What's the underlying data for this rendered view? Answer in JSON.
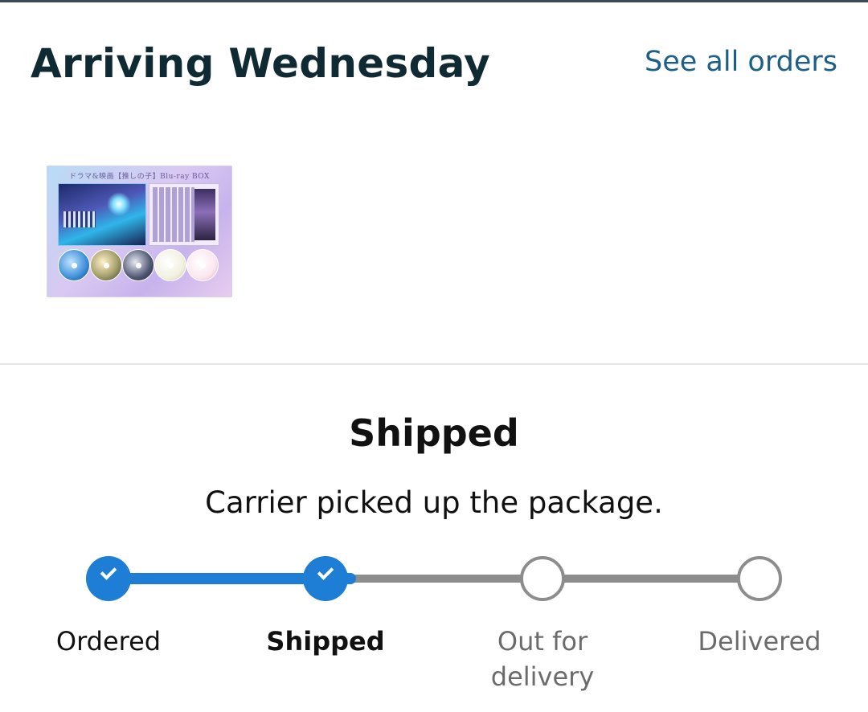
{
  "header": {
    "title": "Arriving Wednesday",
    "see_all_link": "See all orders"
  },
  "item": {
    "thumbnail_caption": "ドラマ&映画【推しの子】Blu-ray BOX"
  },
  "status": {
    "title": "Shipped",
    "description": "Carrier picked up the package."
  },
  "tracker": {
    "progress_fraction": 0.38,
    "steps": [
      {
        "label": "Ordered",
        "state": "complete"
      },
      {
        "label": "Shipped",
        "state": "current"
      },
      {
        "label": "Out for delivery",
        "state": "pending"
      },
      {
        "label": "Delivered",
        "state": "pending"
      }
    ]
  },
  "colors": {
    "progress_blue": "#1e7ed6",
    "link_blue": "#1d5f87",
    "inactive_gray": "#8d8d8d",
    "title_dark": "#0f2a33"
  },
  "icons": [
    "check-icon"
  ]
}
